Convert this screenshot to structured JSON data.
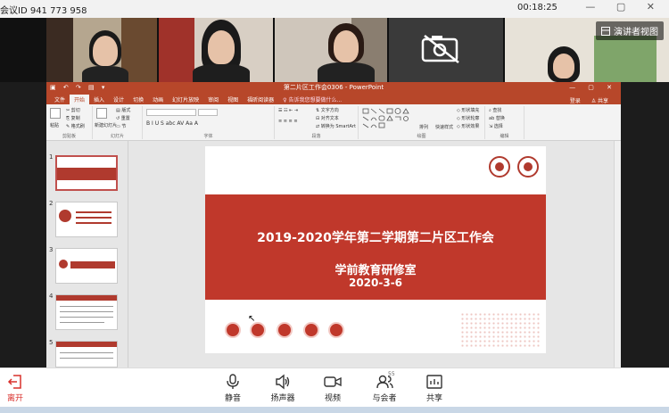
{
  "meeting": {
    "id_text": "会议ID 941 773 958",
    "elapsed": "00:18:25",
    "controls": "— ▢ ✕"
  },
  "videos": {
    "presenter_view_label": "演讲者视图"
  },
  "ppt": {
    "window_title": "第二片区工作会0306 - PowerPoint",
    "quick_access": "▣ ↶ ↷ ▤ ▾",
    "window_controls": "— ▢ ✕",
    "tabs": [
      "文件",
      "开始",
      "插入",
      "设计",
      "切换",
      "动画",
      "幻灯片放映",
      "审阅",
      "视图",
      "福昕阅读器"
    ],
    "tell_me": "♀ 告诉我您想要做什么...",
    "account": "登录",
    "share": "♙ 共享",
    "ribbon": {
      "groups": [
        "剪贴板",
        "幻灯片",
        "字体",
        "段落",
        "绘图",
        "编辑"
      ],
      "clipboard": {
        "paste": "粘贴",
        "cut": "✂ 剪切",
        "copy": "⎘ 复制",
        "format": "✎ 格式刷"
      },
      "slides": {
        "new": "新建幻灯片",
        "layout": "▤ 版式",
        "reset": "↺ 重置",
        "section": "▭ 节"
      },
      "font": {
        "row2": "B I U S abc AV Aa A"
      },
      "paragraph": {
        "direction": "⇅ 文字方向",
        "align": "⊟ 对齐文本",
        "smartart": "⇄ 转换为 SmartArt"
      },
      "drawing": {
        "arrange": "排列",
        "quick_styles": "快速样式",
        "fill": "◇ 形状填充",
        "outline": "◇ 形状轮廓",
        "effect": "◇ 形状效果"
      },
      "editing": {
        "find": "⌕ 查找",
        "replace": "ab 替换",
        "select": "⇲ 选择"
      }
    },
    "slide_numbers": [
      "1",
      "2",
      "3",
      "4",
      "5"
    ],
    "slide": {
      "title": "2019-2020学年第二学期第二片区工作会",
      "subtitle": "学前教育研修室",
      "date": "2020-3-6"
    }
  },
  "toolbar": {
    "leave": "离开",
    "mute": "静音",
    "speaker": "扬声器",
    "video": "视频",
    "participants": "与会者",
    "participants_count": "55",
    "share": "共享"
  },
  "colors": {
    "ppt_red": "#b7472a",
    "slide_red": "#c0382b",
    "leave_red": "#d9302c"
  }
}
